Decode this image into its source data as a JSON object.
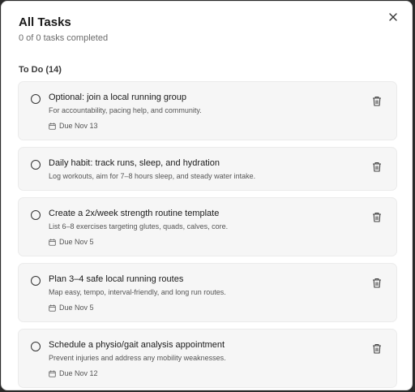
{
  "modal": {
    "title": "All Tasks",
    "subtitle": "0 of 0 tasks completed",
    "section_label": "To Do (14)"
  },
  "tasks": [
    {
      "title": "Optional: join a local running group",
      "description": "For accountability, pacing help, and community.",
      "due": "Due Nov 13"
    },
    {
      "title": "Daily habit: track runs, sleep, and hydration",
      "description": "Log workouts, aim for 7–8 hours sleep, and steady water intake.",
      "due": ""
    },
    {
      "title": "Create a 2x/week strength routine template",
      "description": "List 6–8 exercises targeting glutes, quads, calves, core.",
      "due": "Due Nov 5"
    },
    {
      "title": "Plan 3–4 safe local running routes",
      "description": "Map easy, tempo, interval-friendly, and long run routes.",
      "due": "Due Nov 5"
    },
    {
      "title": "Schedule a physio/gait analysis appointment",
      "description": "Prevent injuries and address any mobility weaknesses.",
      "due": "Due Nov 12"
    }
  ],
  "icons": {
    "close": "close-icon",
    "radio": "checkbox-circle-icon",
    "calendar": "calendar-icon",
    "trash": "trash-icon"
  },
  "colors": {
    "card_bg": "#f6f6f6",
    "text_primary": "#1a1a1a",
    "text_secondary": "#555555"
  }
}
